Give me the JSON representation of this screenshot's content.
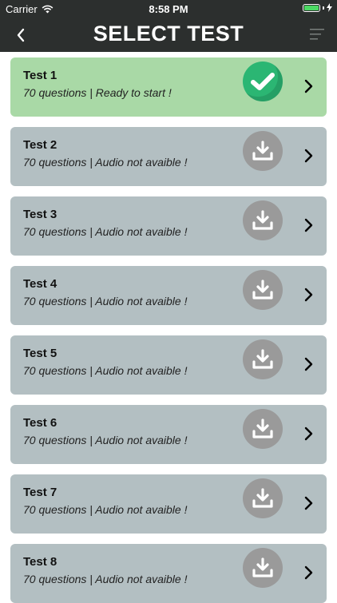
{
  "status_bar": {
    "carrier": "Carrier",
    "time": "8:58 PM",
    "battery_color": "#4cd964"
  },
  "nav": {
    "title": "SELECT TEST",
    "back_icon": "chevron-left-icon",
    "menu_icon": "menu-icon"
  },
  "tests": [
    {
      "title": "Test 1",
      "subtitle": "70 questions | Ready to start !",
      "state": "ready"
    },
    {
      "title": "Test 2",
      "subtitle": "70 questions | Audio not avaible !",
      "state": "download"
    },
    {
      "title": "Test 3",
      "subtitle": "70 questions | Audio not avaible !",
      "state": "download"
    },
    {
      "title": "Test 4",
      "subtitle": "70 questions | Audio not avaible !",
      "state": "download"
    },
    {
      "title": "Test 5",
      "subtitle": "70 questions | Audio not avaible !",
      "state": "download"
    },
    {
      "title": "Test 6",
      "subtitle": "70 questions | Audio not avaible !",
      "state": "download"
    },
    {
      "title": "Test 7",
      "subtitle": "70 questions | Audio not avaible !",
      "state": "download"
    },
    {
      "title": "Test 8",
      "subtitle": "70 questions | Audio not avaible !",
      "state": "download"
    }
  ],
  "colors": {
    "bar": "#2c2f2e",
    "ready_card": "#a9d9a6",
    "pending_card": "#b3bfc2",
    "check_circle": "#2bb673",
    "download_circle": "#9a9a9a"
  }
}
